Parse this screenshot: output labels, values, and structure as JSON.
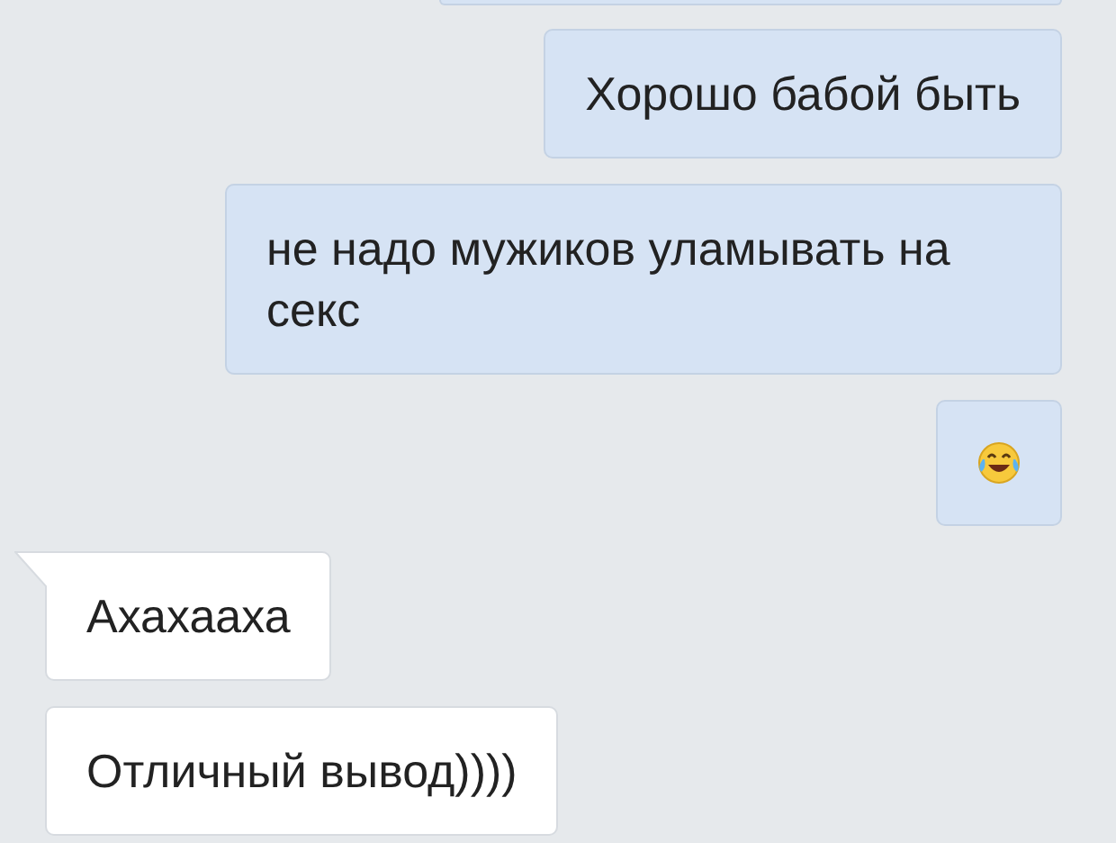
{
  "messages": [
    {
      "kind": "text",
      "outgoing": true,
      "text": "Хорошо бабой быть"
    },
    {
      "kind": "text",
      "outgoing": true,
      "text": "не надо мужиков уламывать на секс"
    },
    {
      "kind": "emoji",
      "outgoing": true
    },
    {
      "kind": "text",
      "outgoing": false,
      "text": "Ахахааха",
      "tail": true
    },
    {
      "kind": "text",
      "outgoing": false,
      "text": "Отличный вывод))))"
    }
  ]
}
